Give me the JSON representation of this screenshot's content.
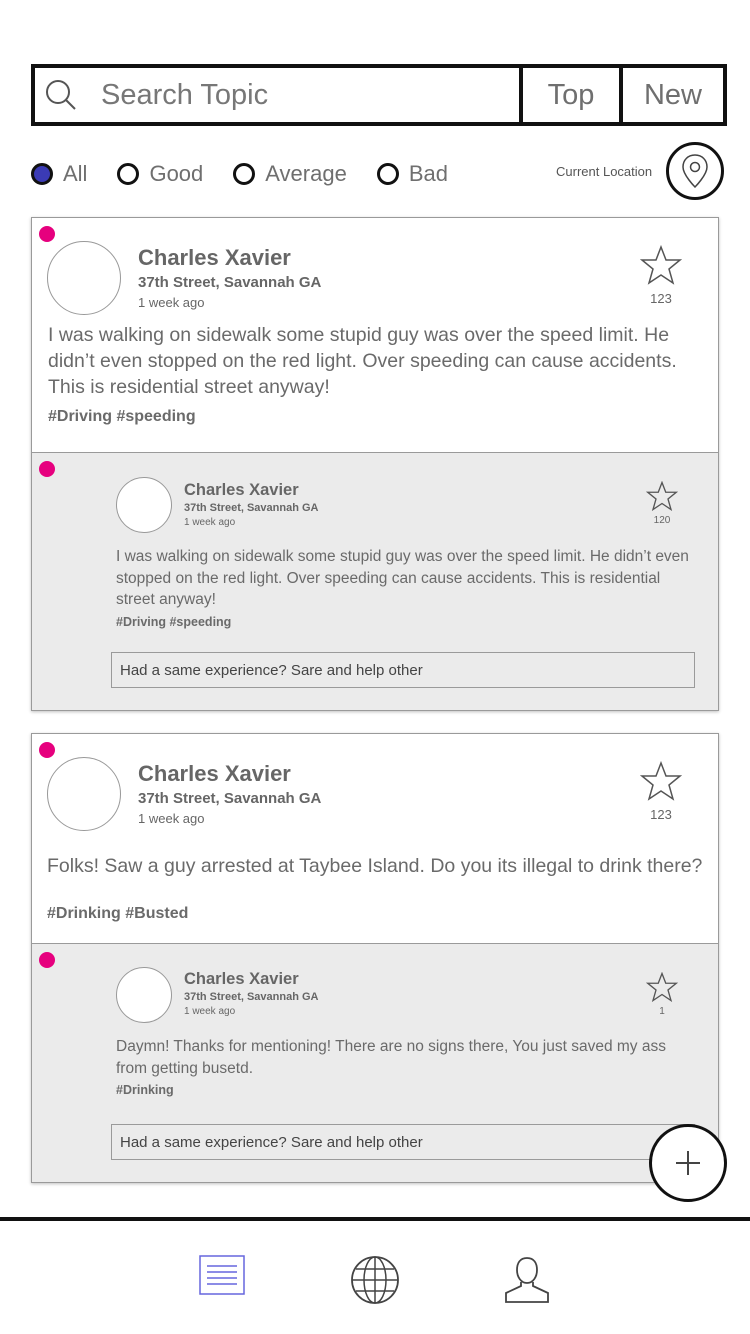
{
  "search": {
    "placeholder": "Search Topic",
    "top_label": "Top",
    "new_label": "New"
  },
  "filters": [
    {
      "label": "All",
      "selected": true
    },
    {
      "label": "Good",
      "selected": false
    },
    {
      "label": "Average",
      "selected": false
    },
    {
      "label": "Bad",
      "selected": false
    }
  ],
  "location": {
    "label": "Current Location"
  },
  "colors": {
    "accent": "#3b3bb5",
    "status_dot": "#e6007e",
    "reply_bg": "#ebebeb"
  },
  "posts": [
    {
      "author": "Charles Xavier",
      "address": "37th Street, Savannah GA",
      "time": "1 week ago",
      "stars": "123",
      "text": "I was walking on sidewalk some stupid guy was over the speed limit. He didn’t even stopped on the red light. Over speeding can cause accidents. This is residential street anyway!",
      "tags": "#Driving #speeding",
      "reply": {
        "author": "Charles Xavier",
        "address": "37th Street, Savannah GA",
        "time": "1 week ago",
        "stars": "120",
        "text": "I was walking on sidewalk some stupid guy was over the speed limit. He didn’t even stopped on the red light. Over speeding can cause accidents. This is residential street anyway!",
        "tags": "#Driving #speeding",
        "input_placeholder": "Had a same experience? Sare and help other"
      }
    },
    {
      "author": "Charles Xavier",
      "address": "37th Street, Savannah GA",
      "time": "1 week ago",
      "stars": "123",
      "text": "Folks! Saw a guy arrested at Taybee Island. Do you its illegal to drink there?",
      "tags": "#Drinking #Busted",
      "reply": {
        "author": "Charles Xavier",
        "address": "37th Street, Savannah GA",
        "time": "1 week ago",
        "stars": "1",
        "text": "Daymn! Thanks for mentioning! There are no signs there, You just saved my ass from getting busetd.",
        "tags": "#Drinking",
        "input_placeholder": "Had a same experience? Sare and help other"
      }
    }
  ],
  "nav": {
    "items": [
      {
        "icon": "list-icon",
        "active": true
      },
      {
        "icon": "globe-icon",
        "active": false
      },
      {
        "icon": "profile-icon",
        "active": false
      }
    ]
  }
}
